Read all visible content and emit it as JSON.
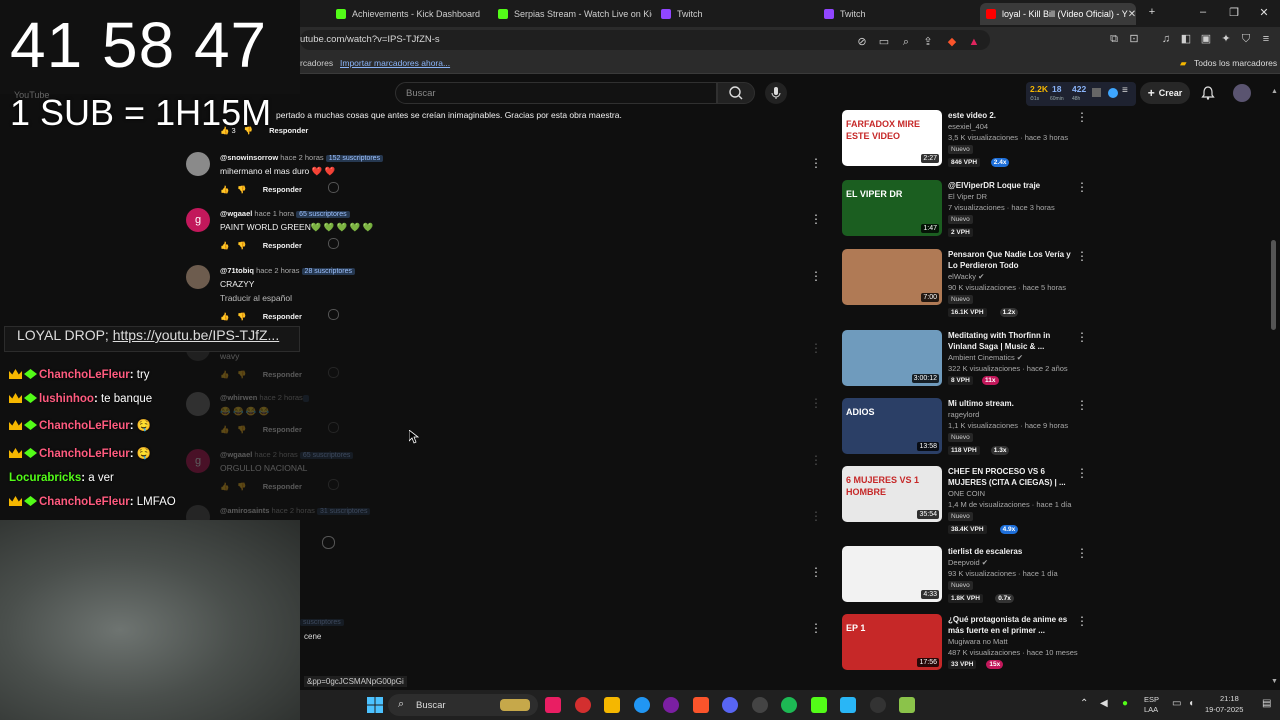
{
  "browser": {
    "tabs": [
      {
        "title": "Achievements - Kick Dashboard",
        "favicon_color": "#53fc18"
      },
      {
        "title": "Serpias Stream - Watch Live on Kick",
        "favicon_color": "#53fc18"
      },
      {
        "title": "Twitch",
        "favicon_color": "#9146ff"
      },
      {
        "title": "Twitch",
        "favicon_color": "#9146ff"
      },
      {
        "title": "loyal - Kill Bill (Video Oficial) - Y",
        "favicon_color": "#ff0000",
        "active": true
      }
    ],
    "new_tab": "+",
    "url": "utube.com/watch?v=IPS-TJfZN-s",
    "bookmarks": {
      "prefix": "rcadores",
      "import_link": "Importar marcadores ahora...",
      "all": "Todos los marcadores"
    }
  },
  "youtube": {
    "search_placeholder": "Buscar",
    "stats": {
      "subs": "2.2K",
      "subs_sub": "⏱1s",
      "a": "18",
      "a_sub": "60min",
      "b": "422",
      "b_sub": "48h"
    },
    "create_label": "Crear",
    "logo_text": "YouTube"
  },
  "comments": [
    {
      "user": "",
      "time": "",
      "subs": "",
      "text": "pertado a muchas cosas que antes se creían inimaginables. Gracias por esta obra maestra.",
      "text2": "",
      "likes": "3",
      "reply": "Responder",
      "avatar_color": "#555",
      "dim": false
    },
    {
      "user": "@snowinsorrow",
      "time": "hace 2 horas",
      "subs": "152 suscriptores",
      "text": "mihermano el mas duro ❤️ ❤️",
      "text2": "",
      "likes": "",
      "reply": "Responder",
      "avatar_color": "#8a8a8a",
      "dim": false
    },
    {
      "user": "@wgaael",
      "time": "hace 1 hora",
      "subs": "65 suscriptores",
      "text": "PAINT WORLD GREEN💚 💚 💚 💚 💚",
      "text2": "",
      "likes": "",
      "reply": "Responder",
      "avatar_color": "#c2185b",
      "avatar_letter": "g",
      "dim": false
    },
    {
      "user": "@71tobiq",
      "time": "hace 2 horas",
      "subs": "28 suscriptores",
      "text": "CRAZYY",
      "text2": "Traducir al español",
      "likes": "",
      "reply": "Responder",
      "avatar_color": "#6d5c4e",
      "dim": false
    },
    {
      "user": "",
      "time": "",
      "subs": "1,88 K suscriptores",
      "text": "wavy",
      "text2": "",
      "likes": "",
      "reply": "Responder",
      "avatar_color": "#444",
      "dim": true
    },
    {
      "user": "@whirwen",
      "time": "hace 2 horas",
      "subs": "",
      "text": "😂 😂 😂 😂",
      "text2": "",
      "likes": "",
      "reply": "Responder",
      "avatar_color": "#777",
      "dim": true
    },
    {
      "user": "@wgaael",
      "time": "hace 2 horas",
      "subs": "65 suscriptores",
      "text": "ORGULLO NACIONAL",
      "text2": "",
      "likes": "",
      "reply": "Responder",
      "avatar_color": "#c2185b",
      "avatar_letter": "g",
      "dim": true
    },
    {
      "user": "@amirosaints",
      "time": "hace 2 horas",
      "subs": "31 suscriptores",
      "text": "er",
      "text2": "",
      "likes": "",
      "reply": "",
      "avatar_color": "#555",
      "dim": true
    }
  ],
  "comments_tail": {
    "subs": "suscriptores",
    "text": "cene",
    "link_fragment": "&pp=0gcJCSMANpG00pGi"
  },
  "recommendations": [
    {
      "title": "este video 2.",
      "channel": "esexiel_404",
      "verified": false,
      "meta": "3,5 K visualizaciones · hace 3 horas",
      "new": "Nuevo",
      "vph": "846 VPH",
      "mult": "2.4x",
      "mult_color": "#1e6fd9",
      "duration": "2:27",
      "thumb": "#ffffff",
      "thumb_label": "FARFADOX MIRE ESTE VIDEO"
    },
    {
      "title": "@ElViperDR Loque traje",
      "channel": "El Viper DR",
      "verified": false,
      "meta": "7 visualizaciones · hace 3 horas",
      "new": "Nuevo",
      "vph": "2 VPH",
      "mult": "",
      "mult_color": "",
      "duration": "1:47",
      "thumb": "#1b5e20",
      "thumb_label": "EL VIPER DR"
    },
    {
      "title": "Pensaron Que Nadie Los Vería y Lo Perdieron Todo",
      "channel": "elWacky",
      "verified": true,
      "meta": "90 K visualizaciones · hace 5 horas",
      "new": "Nuevo",
      "vph": "16.1K VPH",
      "mult": "1.2x",
      "mult_color": "#333",
      "duration": "7:00",
      "thumb": "#b07a55",
      "thumb_label": ""
    },
    {
      "title": "Meditating with Thorfinn in Vinland Saga | Music & ...",
      "channel": "Ambient Cinematics",
      "verified": true,
      "meta": "322 K visualizaciones · hace 2 años",
      "new": "",
      "vph": "8 VPH",
      "mult": "11x",
      "mult_color": "#c2185b",
      "duration": "3:00:12",
      "thumb": "#6f9bbd",
      "thumb_label": ""
    },
    {
      "title": "Mi ultimo stream.",
      "channel": "rageylord",
      "verified": false,
      "meta": "1,1 K visualizaciones · hace 9 horas",
      "new": "Nuevo",
      "vph": "118 VPH",
      "mult": "1.3x",
      "mult_color": "#333",
      "duration": "13:58",
      "thumb": "#2b3f66",
      "thumb_label": "ADIOS"
    },
    {
      "title": "CHEF EN PROCESO VS 6 MUJERES (CITA A CIEGAS) | ...",
      "channel": "ONE COIN",
      "verified": false,
      "meta": "1,4 M de visualizaciones · hace 1 día",
      "new": "Nuevo",
      "vph": "38.4K VPH",
      "mult": "4.9x",
      "mult_color": "#1e6fd9",
      "duration": "35:54",
      "thumb": "#e8e8e8",
      "thumb_label": "6 MUJERES VS 1 HOMBRE"
    },
    {
      "title": "tierlist de escaleras",
      "channel": "Deepvoid",
      "verified": true,
      "meta": "93 K visualizaciones · hace 1 día",
      "new": "Nuevo",
      "vph": "1.8K VPH",
      "mult": "0.7x",
      "mult_color": "#333",
      "duration": "4:33",
      "thumb": "#f2f2f2",
      "thumb_label": ""
    },
    {
      "title": "¿Qué protagonista de anime es más fuerte en el primer ...",
      "channel": "Mugiwara no Matt",
      "verified": false,
      "meta": "487 K visualizaciones · hace 10 meses",
      "new": "",
      "vph": "33 VPH",
      "mult": "15x",
      "mult_color": "#c2185b",
      "duration": "17:56",
      "thumb": "#c62828",
      "thumb_label": "EP 1"
    }
  ],
  "overlay": {
    "timer": "41 58 47",
    "sub_rule": "1 SUB = 1H15M",
    "chat_link_label": "LOYAL DROP; ",
    "chat_link_url": "https://youtu.be/IPS-TJfZ...",
    "chat": [
      {
        "user": "ChanchoLeFleur",
        "color": "#ff5b7f",
        "msg": "try",
        "badges": true
      },
      {
        "user": "lushinhoo",
        "color": "#ff5b7f",
        "msg": "te banque",
        "badges": true
      },
      {
        "user": "ChanchoLeFleur",
        "color": "#ff5b7f",
        "msg": "🤤",
        "badges": true
      },
      {
        "user": "ChanchoLeFleur",
        "color": "#ff5b7f",
        "msg": "🤤",
        "badges": true
      },
      {
        "user": "Locurabricks",
        "color": "#53fc18",
        "msg": "a ver",
        "badges": false
      },
      {
        "user": "ChanchoLeFleur",
        "color": "#ff5b7f",
        "msg": "LMFAO",
        "badges": true
      }
    ]
  },
  "taskbar": {
    "search": "Buscar",
    "lang": "ESP",
    "lang2": "LAA",
    "time": "21:18",
    "date": "19-07-2025"
  }
}
